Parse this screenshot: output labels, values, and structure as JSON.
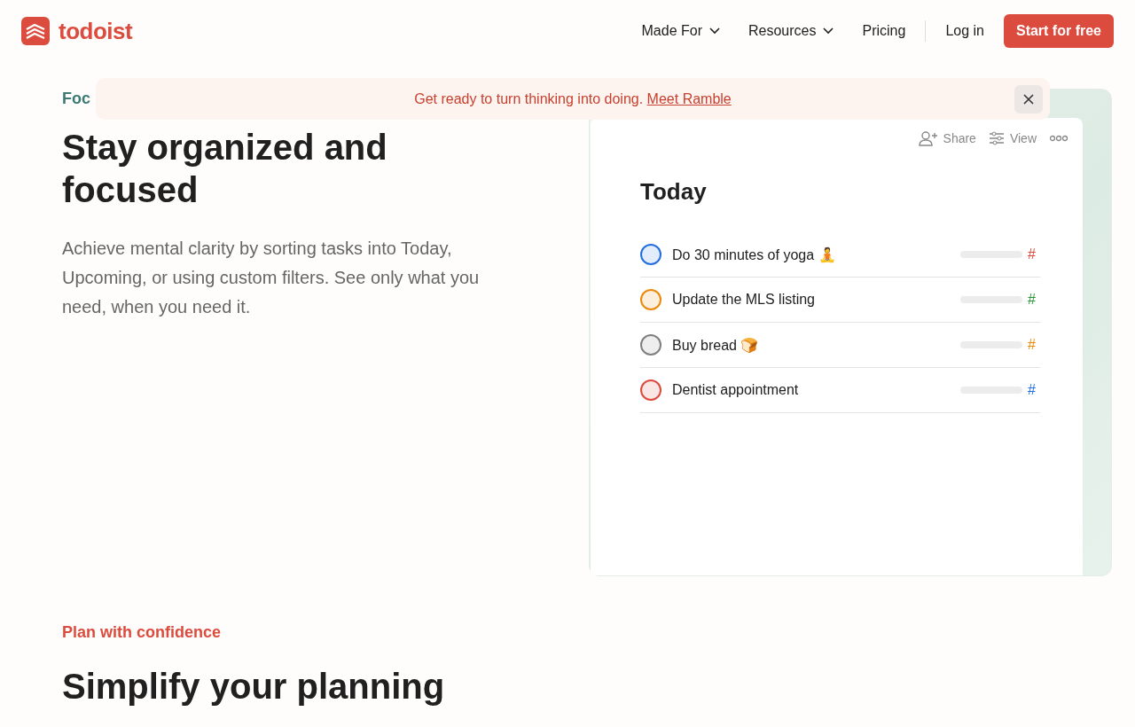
{
  "header": {
    "logo": "todoist",
    "nav": [
      {
        "label": "Made For",
        "kind": "dropdown"
      },
      {
        "label": "Resources",
        "kind": "dropdown"
      },
      {
        "label": "Pricing",
        "kind": "link"
      }
    ],
    "login": "Log in",
    "cta": "Start for free"
  },
  "banner": {
    "text": "Get ready to turn thinking into doing.",
    "link": "Meet Ramble"
  },
  "sections": [
    {
      "eyebrow": "Foc",
      "color": "#3d7a72",
      "title": "Stay organized and focused",
      "body": "Achieve mental clarity by sorting tasks into Today, Upcoming, or using custom filters. See only what you need, when you need it."
    },
    {
      "eyebrow": "Plan with confidence",
      "color": "#dc4c3e",
      "title": "Simplify your planning"
    }
  ],
  "preview": {
    "toolbar": [
      "Share",
      "View"
    ],
    "title": "Today",
    "tasks": [
      {
        "text": "Do 30 minutes of yoga 🧘",
        "color": "#246fe0",
        "tag": {
          "text": "#",
          "color": "#dc4c3e"
        }
      },
      {
        "text": "Update the MLS listing",
        "color": "#eb8909",
        "tag": {
          "text": "#",
          "color": "#299438"
        }
      },
      {
        "text": "Buy bread 🍞",
        "color": "#808080",
        "tag": {
          "text": "#",
          "color": "#eb8909"
        }
      },
      {
        "text": "Dentist appointment",
        "color": "#dc4c3e",
        "tag": {
          "text": "#",
          "color": "#246fe0"
        }
      }
    ]
  }
}
